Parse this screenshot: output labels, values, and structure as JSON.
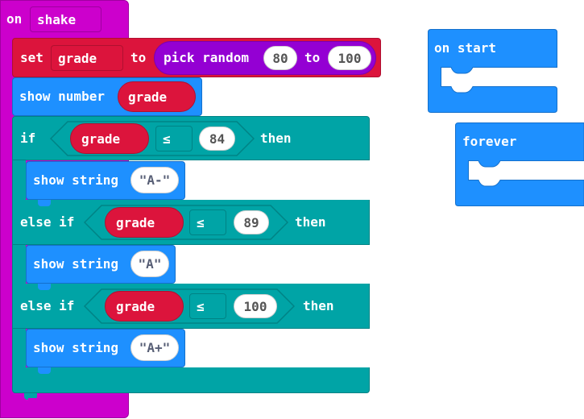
{
  "on_shake": {
    "keyword": "on",
    "event": "shake"
  },
  "set_block": {
    "keyword": "set",
    "variable": "grade",
    "to": "to",
    "reporter_label": "pick random",
    "from": "80",
    "to_word": "to",
    "to_value": "100"
  },
  "show_number": {
    "label": "show number",
    "variable": "grade"
  },
  "if_block": {
    "if_label": "if",
    "variable": "grade",
    "operator": "≤",
    "value": "84",
    "then": "then",
    "body": {
      "label": "show string",
      "value": "\"A-\""
    }
  },
  "else_if_1": {
    "label": "else if",
    "variable": "grade",
    "operator": "≤",
    "value": "89",
    "then": "then",
    "body": {
      "label": "show string",
      "value": "\"A\""
    }
  },
  "else_if_2": {
    "label": "else if",
    "variable": "grade",
    "operator": "≤",
    "value": "100",
    "then": "then",
    "body": {
      "label": "show string",
      "value": "\"A+\""
    }
  },
  "on_start": {
    "label": "on start"
  },
  "forever": {
    "label": "forever"
  },
  "colors": {
    "event": "#cc00cc",
    "variable": "#dc143c",
    "math": "#9400d3",
    "basic": "#1e90ff",
    "logic": "#00a4a6",
    "comparison_inset": "#008a8c"
  }
}
